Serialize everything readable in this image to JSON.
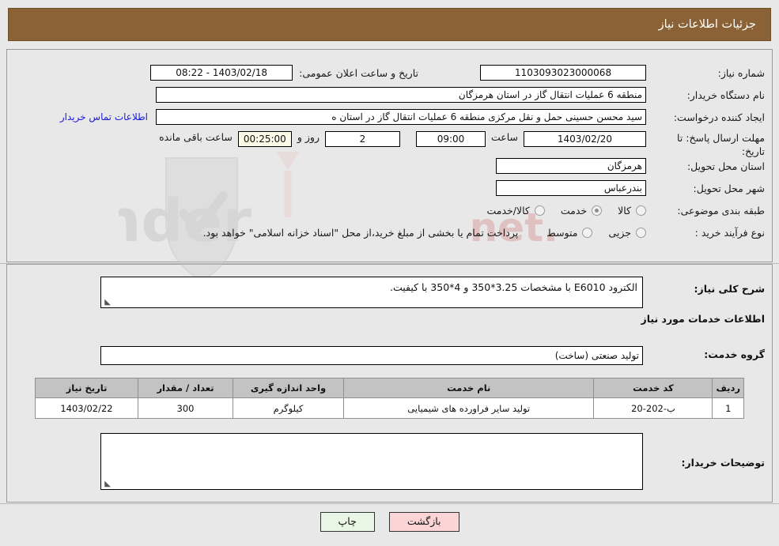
{
  "header": {
    "title": "جزئیات اطلاعات نیاز"
  },
  "form": {
    "need_number_label": "شماره نیاز:",
    "need_number_value": "1103093023000068",
    "announce_datetime_label": "تاریخ و ساعت اعلان عمومی:",
    "announce_datetime_value": "1403/02/18 - 08:22",
    "buyer_org_label": "نام دستگاه خریدار:",
    "buyer_org_value": "منطقه 6 عملیات انتقال گاز در استان هرمزگان",
    "requester_label": "ایجاد کننده درخواست:",
    "requester_value": "سید محسن حسینی حمل و نقل مرکزی منطقه 6 عملیات انتقال گاز در استان ه",
    "contact_link": "اطلاعات تماس خریدار",
    "deadline_label_line1": "مهلت ارسال پاسخ: تا",
    "deadline_label_line2": "تاریخ:",
    "deadline_date": "1403/02/20",
    "deadline_hour_label": "ساعت",
    "deadline_time": "09:00",
    "remaining_days": "2",
    "remaining_days_label": "روز و",
    "remaining_clock": "00:25:00",
    "remaining_suffix_label": "ساعت باقی مانده",
    "province_label": "استان محل تحویل:",
    "province_value": "هرمزگان",
    "city_label": "شهر محل تحویل:",
    "city_value": "بندرعباس",
    "category_label": "طبقه بندی موضوعی:",
    "category_options": [
      {
        "label": "کالا",
        "selected": false
      },
      {
        "label": "خدمت",
        "selected": true
      },
      {
        "label": "کالا/خدمت",
        "selected": false
      }
    ],
    "process_label": "نوع فرآیند خرید :",
    "process_options": [
      {
        "label": "جزیی",
        "selected": false
      },
      {
        "label": "متوسط",
        "selected": false
      }
    ],
    "payment_note": "پرداخت تمام یا بخشی از مبلغ خرید،از محل \"اسناد خزانه اسلامی\" خواهد بود."
  },
  "need_description": {
    "label": "شرح کلی نیاز:",
    "value": "الکترود E6010 با مشخصات 3.25*350 و 4*350 با کیفیت."
  },
  "services_section": {
    "heading": "اطلاعات خدمات مورد نیاز",
    "group_label": "گروه خدمت:",
    "group_value": "تولید صنعتی (ساخت)"
  },
  "table": {
    "columns": [
      "ردیف",
      "کد خدمت",
      "نام خدمت",
      "واحد اندازه گیری",
      "تعداد / مقدار",
      "تاریخ نیاز"
    ],
    "rows": [
      {
        "index": "1",
        "code": "ب-202-20",
        "name": "تولید سایر فراورده های شیمیایی",
        "unit": "کیلوگرم",
        "quantity": "300",
        "need_date": "1403/02/22"
      }
    ]
  },
  "buyer_notes": {
    "label": "توضیحات خریدار:",
    "value": ""
  },
  "buttons": {
    "print": "چاپ",
    "back": "بازگشت"
  },
  "colors": {
    "header_bg": "#8a6236",
    "page_bg": "#e8e8e8",
    "link": "#1919d8",
    "print_btn": "#e9f6e6",
    "back_btn": "#fbd5d5"
  },
  "watermark": {
    "text": "AnaTender.net"
  }
}
